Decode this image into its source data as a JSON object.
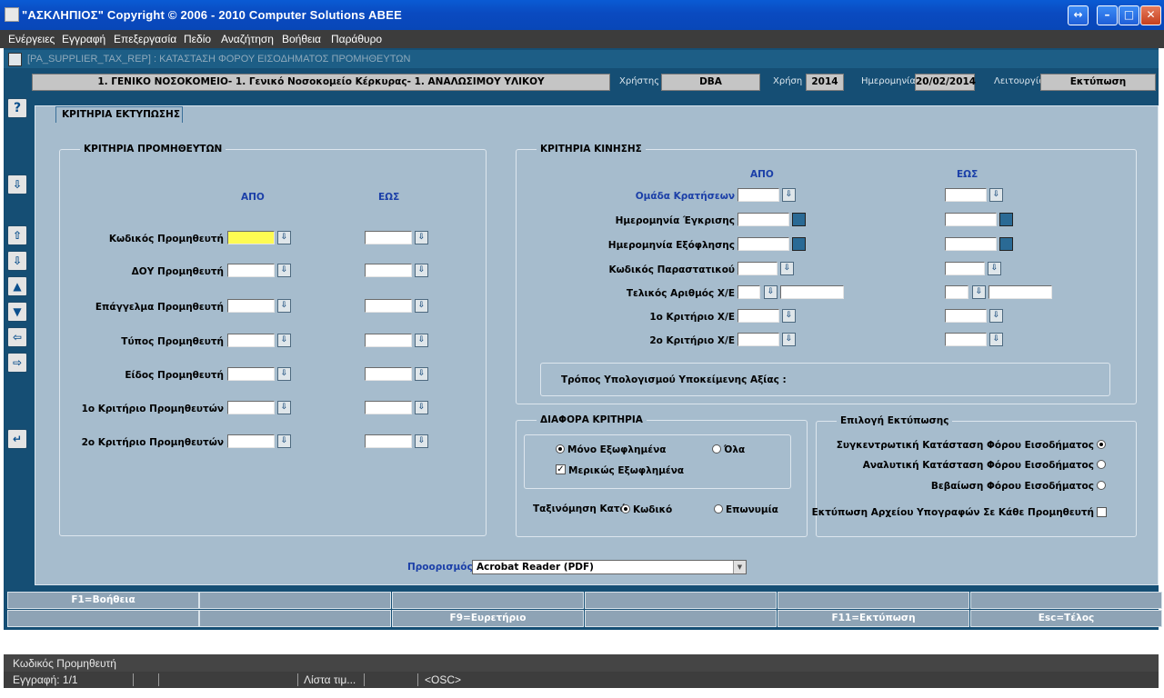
{
  "window": {
    "title": "\"ΑΣΚΛΗΠΙΟΣ\" Copyright © 2006 - 2010 Computer Solutions ABEE"
  },
  "menu": [
    "Ενέργειες",
    "Εγγραφή",
    "Επεξεργασία",
    "Πεδίο",
    "Αναζήτηση",
    "Βοήθεια",
    "Παράθυρο"
  ],
  "form": {
    "caption": "[PA_SUPPLIER_TAX_REP]  :  ΚΑΤΑΣΤΑΣΗ ΦΟΡΟΥ ΕΙΣΟΔΗΜΑΤΟΣ ΠΡΟΜΗΘΕΥΤΩΝ"
  },
  "info": {
    "org": "1. ΓΕΝΙΚΟ ΝΟΣΟΚΟΜΕΙΟ- 1. Γενικό Νοσοκομείο Κέρκυρας- 1. ΑΝΑΛΩΣΙΜΟΥ ΥΛΙΚΟΥ",
    "user_label": "Χρήστης",
    "user": "DBA",
    "year_label": "Χρήση",
    "year": "2014",
    "date_label": "Ημερομηνία",
    "date": "20/02/2014",
    "mode_label": "Λειτουργία",
    "mode": "Εκτύπωση"
  },
  "main_tab": "ΚΡΙΤΗΡΙΑ ΕΚΤΥΠΩΣΗΣ",
  "suppliers": {
    "title": "ΚΡΙΤΗΡΙΑ ΠΡΟΜΗΘΕΥΤΩΝ",
    "from": "ΑΠΟ",
    "to": "ΕΩΣ",
    "rows": [
      "Κωδικός Προμηθευτή",
      "ΔΟΥ Προμηθευτή",
      "Επάγγελμα Προμηθευτή",
      "Τύπος Προμηθευτή",
      "Είδος Προμηθευτή",
      "1ο Κριτήριο Προμηθευτών",
      "2ο Κριτήριο Προμηθευτών"
    ]
  },
  "movement": {
    "title": "ΚΡΙΤΗΡΙΑ ΚΙΝΗΣΗΣ",
    "from": "ΑΠΟ",
    "to": "ΕΩΣ",
    "rows": [
      "Ομάδα Κρατήσεων",
      "Ημερομηνία Έγκρισης",
      "Ημερομηνία Εξόφλησης",
      "Κωδικός Παραστατικού",
      "Τελικός Αριθμός Χ/Ε",
      "1ο Κριτήριο Χ/Ε",
      "2ο Κριτήριο Χ/Ε"
    ],
    "calc_label": "Τρόπος Υπολογισμού Υποκείμενης Αξίας :"
  },
  "misc": {
    "title": "ΔΙΑΦΟΡΑ ΚΡΙΤΗΡΙΑ",
    "only_paid": "Μόνο Εξωφλημένα",
    "all": "Όλα",
    "partial": "Μερικώς Εξωφλημένα",
    "sort_label": "Ταξινόμηση Κατά",
    "sort_code": "Κωδικό",
    "sort_name": "Επωνυμία"
  },
  "print_choice": {
    "title": "Επιλογή Εκτύπωσης",
    "opt1": "Συγκεντρωτική Κατάσταση Φόρου Εισοδήματος",
    "opt2": "Αναλυτική Κατάσταση Φόρου Εισοδήματος",
    "opt3": "Βεβαίωση Φόρου Εισοδήματος",
    "sig": "Εκτύπωση Αρχείου Υπογραφών Σε Κάθε Προμηθευτή"
  },
  "destination": {
    "label": "Προορισμός",
    "value": "Acrobat Reader (PDF)"
  },
  "fkeys_row1": [
    "F1=Βοήθεια",
    "",
    "",
    "",
    "",
    ""
  ],
  "fkeys_row2": [
    "",
    "",
    "F9=Ευρετήριο",
    "",
    "F11=Εκτύπωση",
    "Esc=Τέλος"
  ],
  "status": {
    "field": "Κωδικός Προμηθευτή",
    "record": "Εγγραφή: 1/1",
    "list": "Λίστα τιμ...",
    "osc": "<OSC>"
  },
  "colors": {
    "title_bar": "#0a4ac0",
    "app_bg": "#154e74",
    "panel": "#a6bccd",
    "focused_field": "#fefb52",
    "header_blue": "#1b3fa8"
  }
}
